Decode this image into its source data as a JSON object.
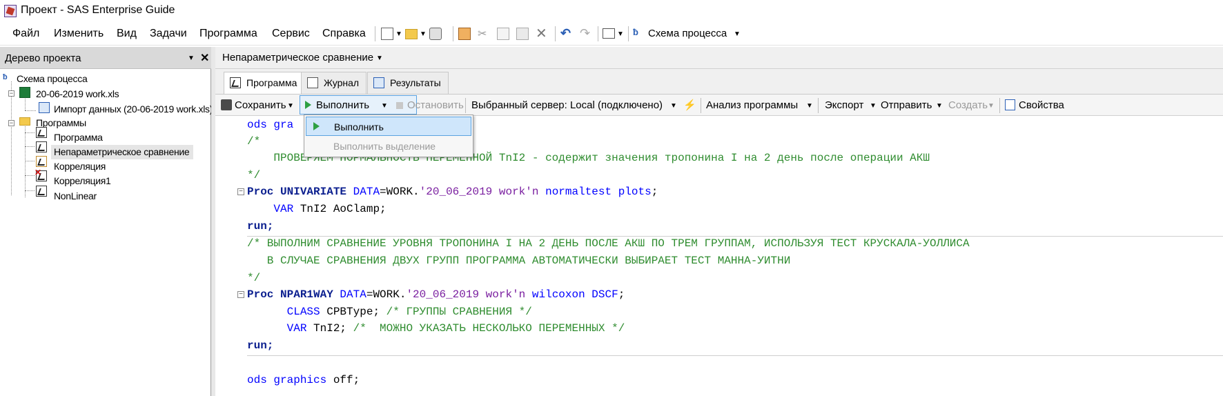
{
  "window": {
    "title": "Проект - SAS Enterprise Guide"
  },
  "menu": {
    "items": [
      "Файл",
      "Изменить",
      "Вид",
      "Задачи",
      "Программа",
      "Сервис",
      "Справка"
    ],
    "process_flow_label": "Схема процесса"
  },
  "project_tree": {
    "title": "Дерево проекта",
    "root": "Схема процесса",
    "file": "20-06-2019 work.xls",
    "import": "Импорт данных (20-06-2019 work.xls)",
    "programs_folder": "Программы",
    "programs": [
      "Программа",
      "Непараметрическое сравнение",
      "Корреляция",
      "Корреляция1",
      "NonLinear"
    ]
  },
  "document": {
    "title": "Непараметрическое сравнение"
  },
  "tabs": [
    "Программа",
    "Журнал",
    "Результаты"
  ],
  "toolbar": {
    "save": "Сохранить",
    "run": "Выполнить",
    "stop": "Остановить",
    "server": "Выбранный сервер: Local (подключено)",
    "analyze": "Анализ программы",
    "export": "Экспорт",
    "send": "Отправить",
    "create": "Создать",
    "properties": "Свойства"
  },
  "run_menu": {
    "run": "Выполнить",
    "run_selection": "Выполнить выделение"
  },
  "code": {
    "l1_a": "ods gra",
    "l2": "/*",
    "l3": "    ПРОВЕРЯЕМ НОРМАЛЬНОСТЬ ПЕРЕМЕННОЙ TnI2 - содержит значения тропонина I на 2 день после операции АКШ",
    "l4": "*/",
    "l5_kw": "Proc UNIVARIATE",
    "l5_data": " DATA",
    "l5_eq": "=WORK.",
    "l5_str": "'20_06_2019 work'n",
    "l5_opts": " normaltest plots",
    "l5_end": ";",
    "l6_var": "    VAR",
    "l6_rest": " TnI2 AoClamp;",
    "l7": "run;",
    "l8": "/* ВЫПОЛНИМ СРАВНЕНИЕ УРОВНЯ ТРОПОНИНА I НА 2 ДЕНЬ ПОСЛЕ АКШ ПО ТРЕМ ГРУППАМ, ИСПОЛЬЗУЯ ТЕСТ КРУСКАЛА-УОЛЛИСА",
    "l9": "   В СЛУЧАЕ СРАВНЕНИЯ ДВУХ ГРУПП ПРОГРАММА АВТОМАТИЧЕСКИ ВЫБИРАЕТ ТЕСТ МАННА-УИТНИ",
    "l10": "*/",
    "l11_kw": "Proc NPAR1WAY",
    "l11_data": " DATA",
    "l11_eq": "=WORK.",
    "l11_str": "'20_06_2019 work'n",
    "l11_opts": " wilcoxon DSCF",
    "l11_end": ";",
    "l12_kw": "      CLASS",
    "l12_rest": " CPBType; ",
    "l12_cm": "/* ГРУППЫ СРАВНЕНИЯ */",
    "l13_kw": "      VAR",
    "l13_rest": " TnI2; ",
    "l13_cm": "/*  МОЖНО УКАЗАТЬ НЕСКОЛЬКО ПЕРЕМЕННЫХ */",
    "l14": "run;",
    "l15_a": "ods graphics",
    "l15_b": " off;"
  }
}
